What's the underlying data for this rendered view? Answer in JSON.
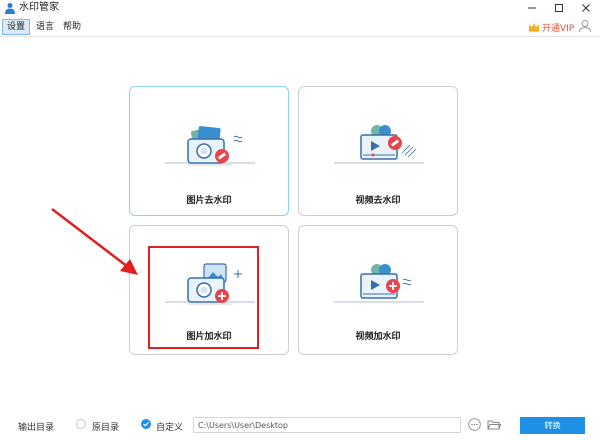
{
  "app": {
    "title": "水印管家"
  },
  "menu": {
    "items": [
      "设置",
      "语言",
      "帮助"
    ]
  },
  "vip": {
    "label": "开通VIP"
  },
  "cards": [
    {
      "label": "图片去水印",
      "icon": "photo-remove-watermark-icon"
    },
    {
      "label": "视频去水印",
      "icon": "video-remove-watermark-icon"
    },
    {
      "label": "图片加水印",
      "icon": "photo-add-watermark-icon"
    },
    {
      "label": "视频加水印",
      "icon": "video-add-watermark-icon"
    }
  ],
  "output": {
    "label": "输出目录",
    "option_original": "原目录",
    "option_custom": "自定义",
    "selected": "自定义",
    "path": "C:\\Users\\User\\Desktop",
    "convert_label": "转换"
  },
  "colors": {
    "accent": "#1e90e6",
    "vip": "#e8532f",
    "annotation": "#e02020",
    "selected_border": "#8fd0ea"
  }
}
